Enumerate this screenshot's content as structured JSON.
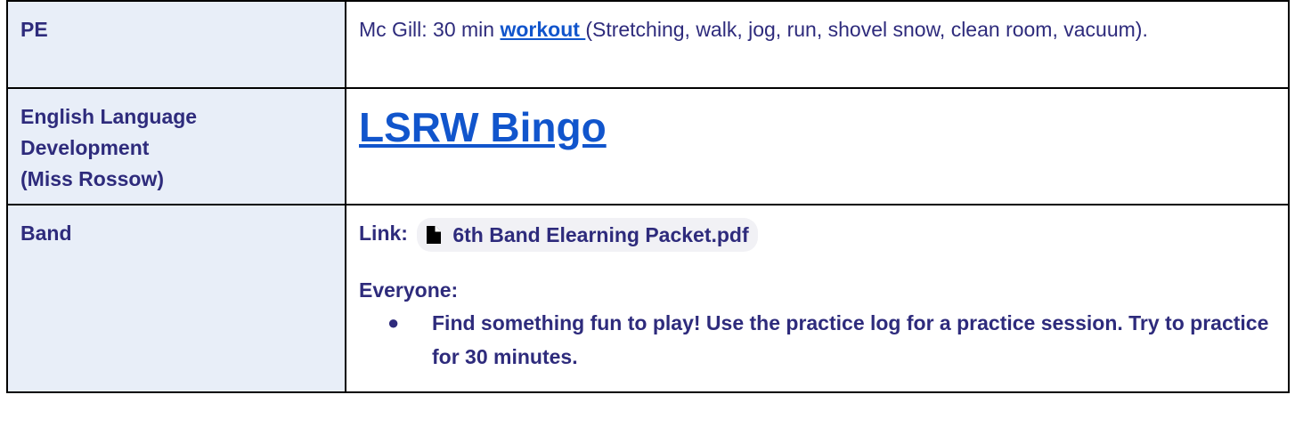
{
  "rows": {
    "pe": {
      "subject": "PE",
      "text_before": "Mc Gill: 30 min ",
      "link_label": "workout ",
      "text_after": "(Stretching, walk, jog, run, shovel snow, clean room, vacuum)."
    },
    "eld": {
      "subject_lines": [
        "English Language",
        "Development",
        "(Miss Rossow)"
      ],
      "link_label": "LSRW Bingo"
    },
    "band": {
      "subject": "Band",
      "link_prefix": "Link:",
      "file_icon": "file-icon",
      "file_name": "6th Band Elearning Packet.pdf",
      "heading": "Everyone:",
      "bullets": [
        "Find something fun to play! Use the practice log for a practice session. Try to practice for 30 minutes."
      ]
    }
  },
  "colors": {
    "subject_bg": "#e8eef8",
    "text": "#2e2b7c",
    "link": "#1155cc",
    "border": "#000000",
    "chip_bg": "#f1f1f5"
  }
}
